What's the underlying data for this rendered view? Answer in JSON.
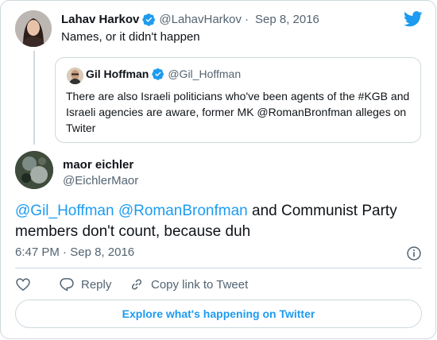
{
  "reply_to": {
    "name": "Lahav Harkov",
    "handle": "@LahavHarkov",
    "separator": "·",
    "date": "Sep 8, 2016",
    "text": "Names, or it didn't happen"
  },
  "quoted": {
    "name": "Gil Hoffman",
    "handle": "@Gil_Hoffman",
    "text": "There are also Israeli politicians who've been agents of the #KGB and Israeli agencies are aware, former MK @RomanBronfman alleges on Twiter"
  },
  "tweet": {
    "name": "maor eichler",
    "handle": "@EichlerMaor",
    "mention1": "@Gil_Hoffman",
    "mention2": "@RomanBronfman",
    "text_rest": " and Communist Party members don't count, because duh",
    "time": "6:47 PM",
    "separator": "·",
    "date": "Sep 8, 2016"
  },
  "actions": {
    "reply_label": "Reply",
    "copy_label": "Copy link to Tweet"
  },
  "explore_label": "Explore what's happening on Twitter",
  "colors": {
    "accent": "#1d9bf0",
    "text": "#0f1419",
    "secondary": "#536471",
    "border": "#cfd9de"
  },
  "icons": [
    "twitter-bird-icon",
    "verified-badge-icon",
    "info-icon",
    "heart-icon",
    "reply-icon",
    "copy-link-icon"
  ]
}
